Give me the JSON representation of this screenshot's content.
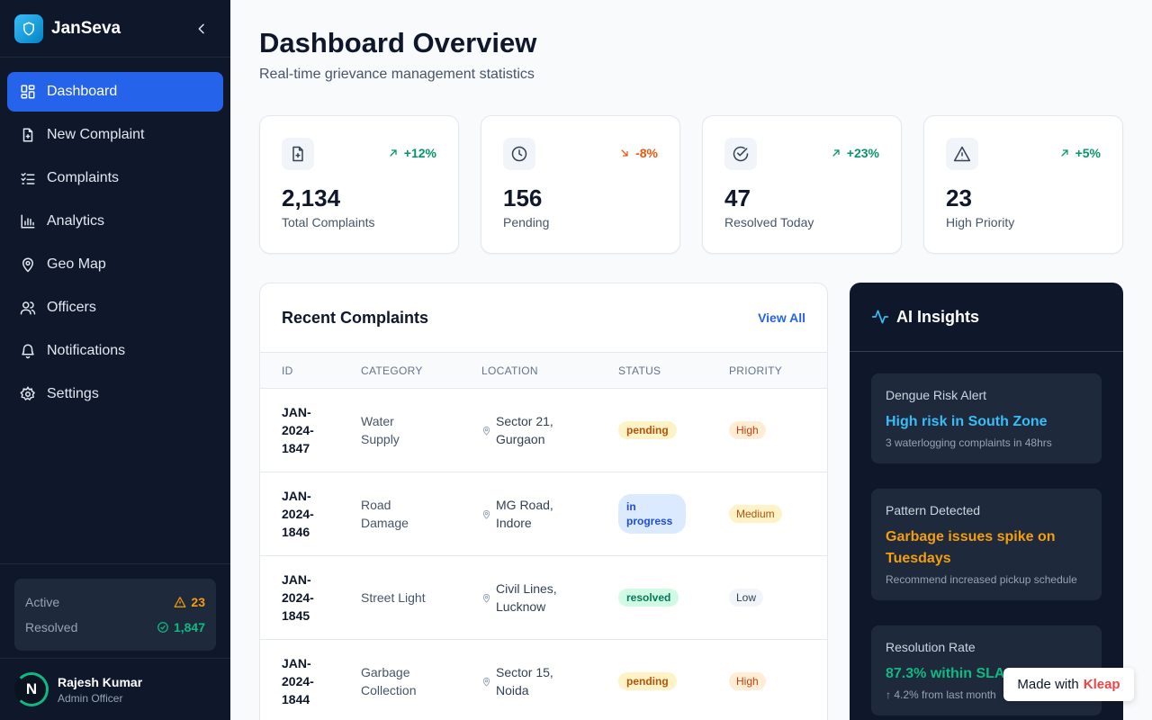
{
  "app": {
    "name": "JanSeva",
    "logo_icon": "shield-icon"
  },
  "nav": {
    "items": [
      {
        "label": "Dashboard",
        "icon": "dashboard-icon",
        "active": true
      },
      {
        "label": "New Complaint",
        "icon": "file-plus-icon"
      },
      {
        "label": "Complaints",
        "icon": "list-check-icon"
      },
      {
        "label": "Analytics",
        "icon": "bar-chart-icon"
      },
      {
        "label": "Geo Map",
        "icon": "map-pin-icon"
      },
      {
        "label": "Officers",
        "icon": "users-icon"
      },
      {
        "label": "Notifications",
        "icon": "bell-icon"
      },
      {
        "label": "Settings",
        "icon": "gear-icon"
      }
    ]
  },
  "sidebar_stats": {
    "active_label": "Active",
    "active_value": "23",
    "resolved_label": "Resolved",
    "resolved_value": "1,847"
  },
  "user": {
    "initial": "N",
    "name": "Rajesh Kumar",
    "role": "Admin Officer"
  },
  "header": {
    "title": "Dashboard Overview",
    "subtitle": "Real-time grievance management statistics"
  },
  "kpis": [
    {
      "value": "2,134",
      "label": "Total Complaints",
      "trend": "+12%",
      "direction": "up",
      "icon": "file-plus-icon"
    },
    {
      "value": "156",
      "label": "Pending",
      "trend": "-8%",
      "direction": "down",
      "icon": "clock-icon"
    },
    {
      "value": "47",
      "label": "Resolved Today",
      "trend": "+23%",
      "direction": "up",
      "icon": "check-circle-icon"
    },
    {
      "value": "23",
      "label": "High Priority",
      "trend": "+5%",
      "direction": "up",
      "icon": "alert-triangle-icon"
    }
  ],
  "recent": {
    "title": "Recent Complaints",
    "view_all": "View All",
    "columns": [
      "ID",
      "CATEGORY",
      "LOCATION",
      "STATUS",
      "PRIORITY"
    ],
    "rows": [
      {
        "id1": "JAN-",
        "id2": "2024-",
        "id3": "1847",
        "cat1": "Water",
        "cat2": "Supply",
        "loc1": "Sector 21,",
        "loc2": "Gurgaon",
        "status": "pending",
        "priority": "High"
      },
      {
        "id1": "JAN-",
        "id2": "2024-",
        "id3": "1846",
        "cat1": "Road",
        "cat2": "Damage",
        "loc1": "MG Road,",
        "loc2": "Indore",
        "status": "in progress",
        "priority": "Medium"
      },
      {
        "id1": "JAN-",
        "id2": "2024-",
        "id3": "1845",
        "cat1": "Street Light",
        "cat2": "",
        "loc1": "Civil Lines,",
        "loc2": "Lucknow",
        "status": "resolved",
        "priority": "Low"
      },
      {
        "id1": "JAN-",
        "id2": "2024-",
        "id3": "1844",
        "cat1": "Garbage",
        "cat2": "Collection",
        "loc1": "Sector 15,",
        "loc2": "Noida",
        "status": "pending",
        "priority": "High"
      }
    ]
  },
  "ai": {
    "title": "AI Insights",
    "insights": [
      {
        "label": "Dengue Risk Alert",
        "headline": "High risk in South Zone",
        "desc": "3 waterlogging complaints in 48hrs",
        "color": "#38bdf8"
      },
      {
        "label": "Pattern Detected",
        "headline": "Garbage issues spike on Tuesdays",
        "desc": "Recommend increased pickup schedule",
        "color": "#f59e0b"
      },
      {
        "label": "Resolution Rate",
        "headline": "87.3% within SLA",
        "desc": "↑ 4.2% from last month",
        "color": "#10b981"
      }
    ]
  },
  "badge": {
    "prefix": "Made with",
    "brand": "Kleap"
  }
}
